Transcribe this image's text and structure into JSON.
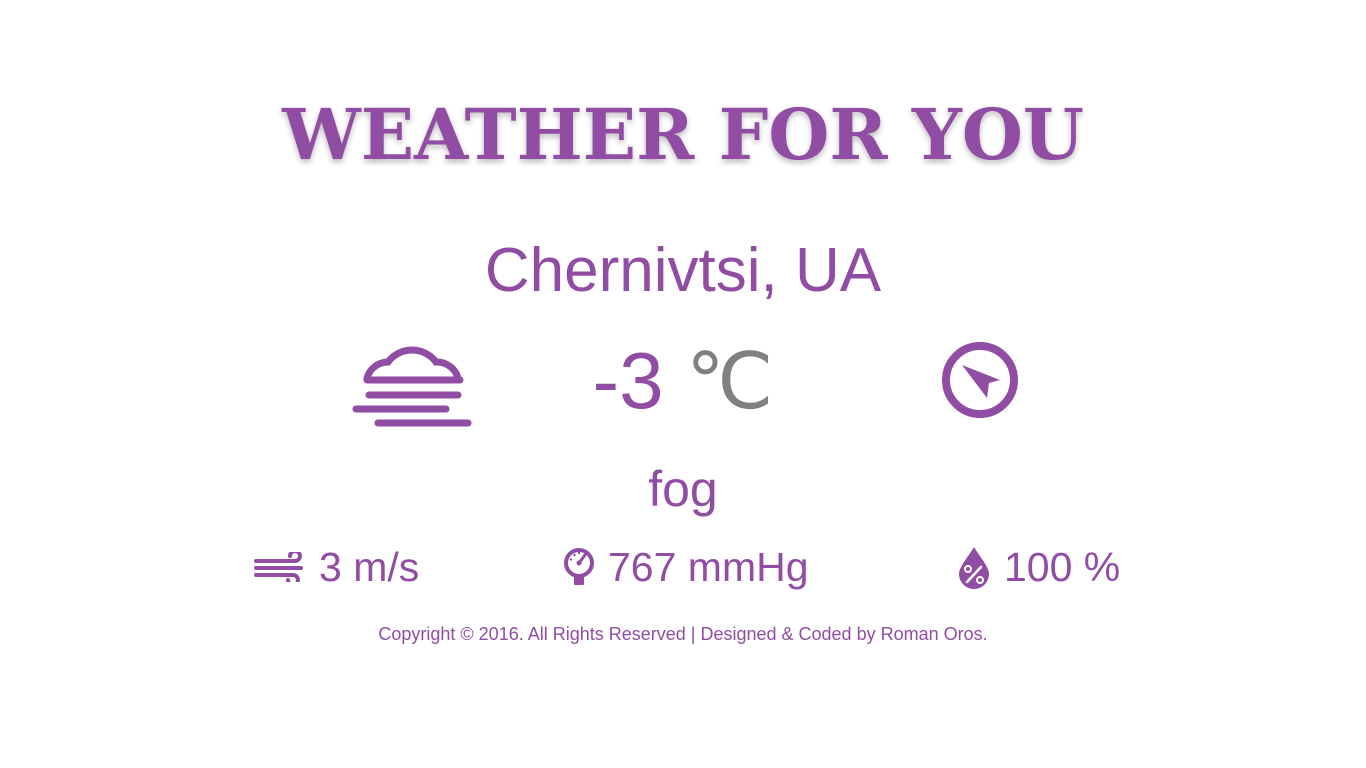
{
  "header": {
    "title": "WEATHER FOR YOU"
  },
  "location": {
    "city": "Chernivtsi, UA"
  },
  "current": {
    "condition_icon": "fog-icon",
    "temperature": "-3",
    "temperature_unit": "℃",
    "direction_icon": "compass-direction-icon",
    "description": "fog"
  },
  "stats": {
    "wind": {
      "icon": "wind-icon",
      "value": "3 m/s"
    },
    "pressure": {
      "icon": "pressure-gauge-icon",
      "value": "767 mmHg"
    },
    "humidity": {
      "icon": "humidity-drop-icon",
      "value": "100 %"
    }
  },
  "footer": {
    "copyright": "Copyright © 2016. All Rights Reserved | Designed & Coded by Roman Oros."
  },
  "colors": {
    "accent": "#914da3",
    "unit_gray": "#808080",
    "background": "#ffffff"
  }
}
